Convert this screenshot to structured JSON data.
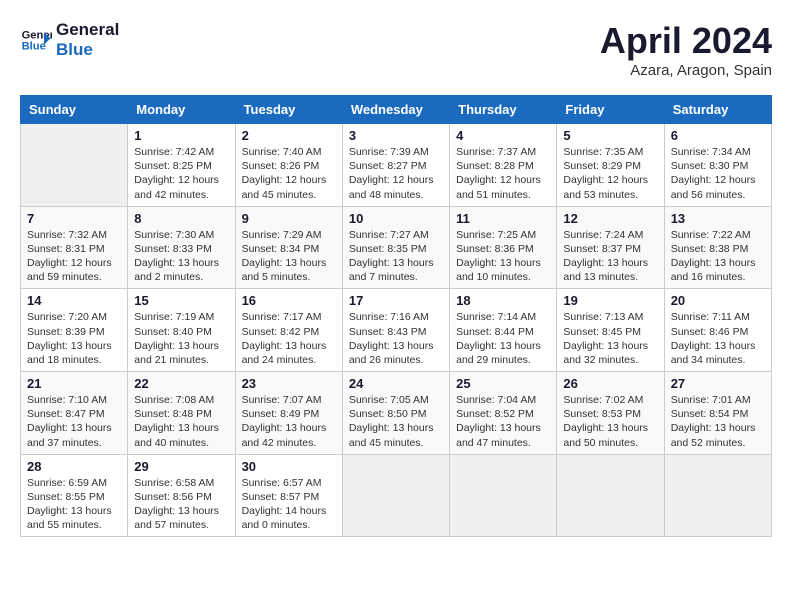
{
  "header": {
    "logo_line1": "General",
    "logo_line2": "Blue",
    "month": "April 2024",
    "location": "Azara, Aragon, Spain"
  },
  "days_of_week": [
    "Sunday",
    "Monday",
    "Tuesday",
    "Wednesday",
    "Thursday",
    "Friday",
    "Saturday"
  ],
  "weeks": [
    [
      {
        "num": "",
        "info": ""
      },
      {
        "num": "1",
        "info": "Sunrise: 7:42 AM\nSunset: 8:25 PM\nDaylight: 12 hours\nand 42 minutes."
      },
      {
        "num": "2",
        "info": "Sunrise: 7:40 AM\nSunset: 8:26 PM\nDaylight: 12 hours\nand 45 minutes."
      },
      {
        "num": "3",
        "info": "Sunrise: 7:39 AM\nSunset: 8:27 PM\nDaylight: 12 hours\nand 48 minutes."
      },
      {
        "num": "4",
        "info": "Sunrise: 7:37 AM\nSunset: 8:28 PM\nDaylight: 12 hours\nand 51 minutes."
      },
      {
        "num": "5",
        "info": "Sunrise: 7:35 AM\nSunset: 8:29 PM\nDaylight: 12 hours\nand 53 minutes."
      },
      {
        "num": "6",
        "info": "Sunrise: 7:34 AM\nSunset: 8:30 PM\nDaylight: 12 hours\nand 56 minutes."
      }
    ],
    [
      {
        "num": "7",
        "info": "Sunrise: 7:32 AM\nSunset: 8:31 PM\nDaylight: 12 hours\nand 59 minutes."
      },
      {
        "num": "8",
        "info": "Sunrise: 7:30 AM\nSunset: 8:33 PM\nDaylight: 13 hours\nand 2 minutes."
      },
      {
        "num": "9",
        "info": "Sunrise: 7:29 AM\nSunset: 8:34 PM\nDaylight: 13 hours\nand 5 minutes."
      },
      {
        "num": "10",
        "info": "Sunrise: 7:27 AM\nSunset: 8:35 PM\nDaylight: 13 hours\nand 7 minutes."
      },
      {
        "num": "11",
        "info": "Sunrise: 7:25 AM\nSunset: 8:36 PM\nDaylight: 13 hours\nand 10 minutes."
      },
      {
        "num": "12",
        "info": "Sunrise: 7:24 AM\nSunset: 8:37 PM\nDaylight: 13 hours\nand 13 minutes."
      },
      {
        "num": "13",
        "info": "Sunrise: 7:22 AM\nSunset: 8:38 PM\nDaylight: 13 hours\nand 16 minutes."
      }
    ],
    [
      {
        "num": "14",
        "info": "Sunrise: 7:20 AM\nSunset: 8:39 PM\nDaylight: 13 hours\nand 18 minutes."
      },
      {
        "num": "15",
        "info": "Sunrise: 7:19 AM\nSunset: 8:40 PM\nDaylight: 13 hours\nand 21 minutes."
      },
      {
        "num": "16",
        "info": "Sunrise: 7:17 AM\nSunset: 8:42 PM\nDaylight: 13 hours\nand 24 minutes."
      },
      {
        "num": "17",
        "info": "Sunrise: 7:16 AM\nSunset: 8:43 PM\nDaylight: 13 hours\nand 26 minutes."
      },
      {
        "num": "18",
        "info": "Sunrise: 7:14 AM\nSunset: 8:44 PM\nDaylight: 13 hours\nand 29 minutes."
      },
      {
        "num": "19",
        "info": "Sunrise: 7:13 AM\nSunset: 8:45 PM\nDaylight: 13 hours\nand 32 minutes."
      },
      {
        "num": "20",
        "info": "Sunrise: 7:11 AM\nSunset: 8:46 PM\nDaylight: 13 hours\nand 34 minutes."
      }
    ],
    [
      {
        "num": "21",
        "info": "Sunrise: 7:10 AM\nSunset: 8:47 PM\nDaylight: 13 hours\nand 37 minutes."
      },
      {
        "num": "22",
        "info": "Sunrise: 7:08 AM\nSunset: 8:48 PM\nDaylight: 13 hours\nand 40 minutes."
      },
      {
        "num": "23",
        "info": "Sunrise: 7:07 AM\nSunset: 8:49 PM\nDaylight: 13 hours\nand 42 minutes."
      },
      {
        "num": "24",
        "info": "Sunrise: 7:05 AM\nSunset: 8:50 PM\nDaylight: 13 hours\nand 45 minutes."
      },
      {
        "num": "25",
        "info": "Sunrise: 7:04 AM\nSunset: 8:52 PM\nDaylight: 13 hours\nand 47 minutes."
      },
      {
        "num": "26",
        "info": "Sunrise: 7:02 AM\nSunset: 8:53 PM\nDaylight: 13 hours\nand 50 minutes."
      },
      {
        "num": "27",
        "info": "Sunrise: 7:01 AM\nSunset: 8:54 PM\nDaylight: 13 hours\nand 52 minutes."
      }
    ],
    [
      {
        "num": "28",
        "info": "Sunrise: 6:59 AM\nSunset: 8:55 PM\nDaylight: 13 hours\nand 55 minutes."
      },
      {
        "num": "29",
        "info": "Sunrise: 6:58 AM\nSunset: 8:56 PM\nDaylight: 13 hours\nand 57 minutes."
      },
      {
        "num": "30",
        "info": "Sunrise: 6:57 AM\nSunset: 8:57 PM\nDaylight: 14 hours\nand 0 minutes."
      },
      {
        "num": "",
        "info": ""
      },
      {
        "num": "",
        "info": ""
      },
      {
        "num": "",
        "info": ""
      },
      {
        "num": "",
        "info": ""
      }
    ]
  ]
}
